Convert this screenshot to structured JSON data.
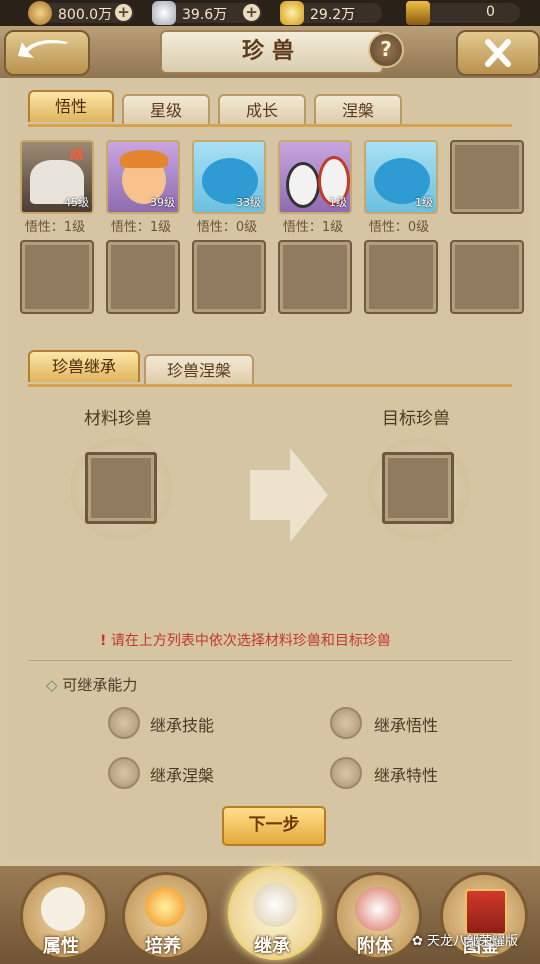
{
  "currency": [
    {
      "icon": "copper-coin-icon",
      "value": "800.0万",
      "has_plus": true
    },
    {
      "icon": "silver-ingot-icon",
      "value": "39.6万",
      "has_plus": true
    },
    {
      "icon": "gold-ingot-icon",
      "value": "29.2万",
      "has_plus": false
    },
    {
      "icon": "treasure-icon",
      "value": "0",
      "has_plus": false
    }
  ],
  "header": {
    "title": "珍兽",
    "help": "?"
  },
  "tabs": [
    "悟性",
    "星级",
    "成长",
    "涅槃"
  ],
  "pets": [
    {
      "level": "45级",
      "wuxing": "悟性：1级",
      "color": "#6b5a48",
      "badge": "战"
    },
    {
      "level": "39级",
      "wuxing": "悟性：1级",
      "color": "#f2a65a"
    },
    {
      "level": "33级",
      "wuxing": "悟性：0级",
      "color": "#3fb0d8"
    },
    {
      "level": "1级",
      "wuxing": "悟性：1级",
      "color": "#7a5b8c"
    },
    {
      "level": "1级",
      "wuxing": "悟性：0级",
      "color": "#3fb0d8"
    }
  ],
  "subtabs": [
    "珍兽继承",
    "珍兽涅槃"
  ],
  "inherit": {
    "material_label": "材料珍兽",
    "target_label": "目标珍兽",
    "hint": "请在上方列表中依次选择材料珍兽和目标珍兽",
    "abilities_title": "可继承能力",
    "options": [
      "继承技能",
      "继承悟性",
      "继承涅槃",
      "继承特性"
    ],
    "next": "下一步"
  },
  "nav": [
    "属性",
    "培养",
    "继承",
    "附体",
    "图鉴"
  ],
  "watermark": "天龙八部荣耀版"
}
